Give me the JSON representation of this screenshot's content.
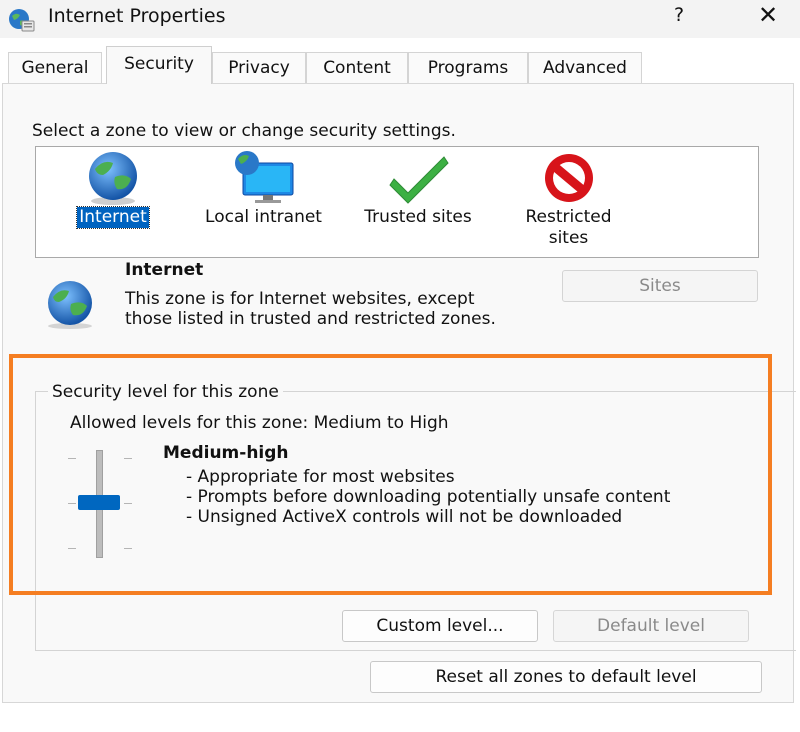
{
  "window": {
    "title": "Internet Properties",
    "help_label": "?",
    "close_label": "✕"
  },
  "tabs": [
    {
      "label": "General",
      "active": false
    },
    {
      "label": "Security",
      "active": true
    },
    {
      "label": "Privacy",
      "active": false
    },
    {
      "label": "Content",
      "active": false
    },
    {
      "label": "Programs",
      "active": false
    },
    {
      "label": "Advanced",
      "active": false
    }
  ],
  "zones": {
    "prompt": "Select a zone to view or change security settings.",
    "items": [
      {
        "label": "Internet",
        "icon": "globe-icon",
        "selected": true
      },
      {
        "label": "Local intranet",
        "icon": "intranet-icon",
        "selected": false
      },
      {
        "label": "Trusted sites",
        "icon": "checkmark-icon",
        "selected": false
      },
      {
        "label": "Restricted sites",
        "icon": "restricted-icon",
        "selected": false
      }
    ]
  },
  "selected_zone": {
    "name": "Internet",
    "description": "This zone is for Internet websites, except those listed in trusted and restricted zones.",
    "sites_label": "Sites"
  },
  "security_level": {
    "group_title": "Security level for this zone",
    "allowed": "Allowed levels for this zone: Medium to High",
    "level_name": "Medium-high",
    "bullets": [
      "- Appropriate for most websites",
      "- Prompts before downloading potentially unsafe content",
      "- Unsigned ActiveX controls will not be downloaded"
    ],
    "custom_label": "Custom level...",
    "default_label": "Default level"
  },
  "reset_label": "Reset all zones to default level",
  "colors": {
    "accent": "#0067c0",
    "highlight": "#f57e22",
    "check": "#3cb043",
    "restricted": "#d7141a"
  }
}
